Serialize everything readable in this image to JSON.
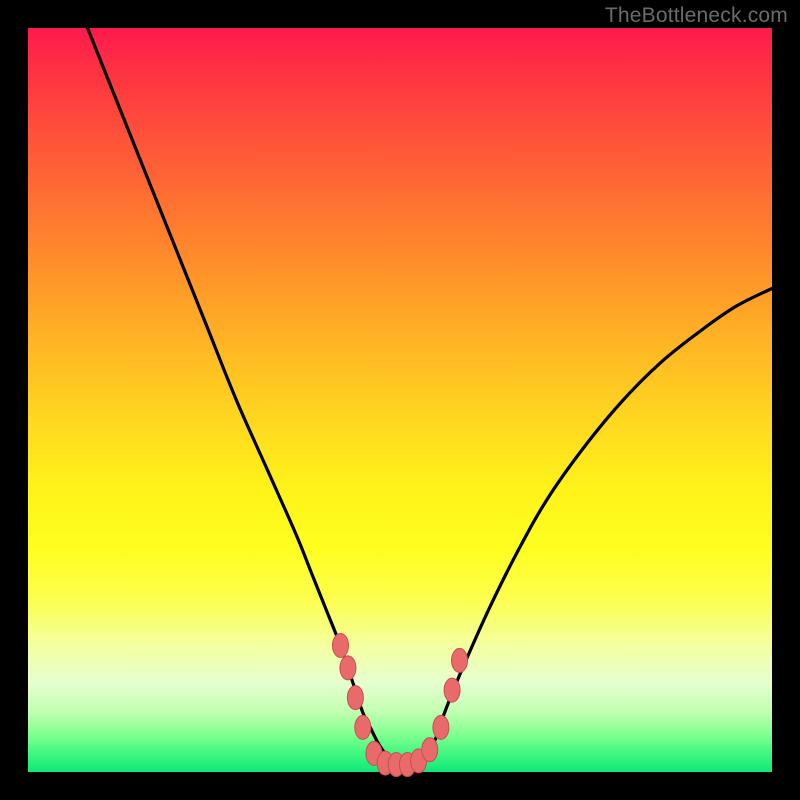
{
  "watermark": "TheBottleneck.com",
  "colors": {
    "frame": "#000000",
    "curve": "#000000",
    "marker_fill": "#e86a6a",
    "marker_stroke": "#c94f4f"
  },
  "chart_data": {
    "type": "line",
    "title": "",
    "xlabel": "",
    "ylabel": "",
    "xlim": [
      0,
      100
    ],
    "ylim": [
      0,
      100
    ],
    "note": "Bottleneck-style V curve; x is normalized component balance (arbitrary), y is bottleneck percentage. Values estimated from pixel positions (no axis ticks present).",
    "series": [
      {
        "name": "bottleneck-curve",
        "x": [
          8,
          12,
          16,
          20,
          24,
          28,
          32,
          36,
          38,
          40,
          42,
          43,
          44,
          45,
          46,
          47,
          48,
          49,
          50,
          51,
          52,
          53,
          54,
          55,
          56,
          58,
          62,
          66,
          70,
          75,
          80,
          85,
          90,
          95,
          100
        ],
        "y": [
          100,
          90,
          80,
          70,
          60,
          50,
          41,
          32,
          27,
          22,
          17,
          14,
          11,
          8,
          6,
          4,
          2.5,
          1.5,
          1,
          1,
          1.2,
          1.8,
          3,
          5,
          8,
          13,
          22,
          30,
          37,
          44,
          50,
          55,
          59,
          62.5,
          65
        ]
      }
    ],
    "markers": {
      "name": "highlight-cluster",
      "points": [
        {
          "x": 42,
          "y": 17
        },
        {
          "x": 43,
          "y": 14
        },
        {
          "x": 44,
          "y": 10
        },
        {
          "x": 45,
          "y": 6
        },
        {
          "x": 46.5,
          "y": 2.5
        },
        {
          "x": 48,
          "y": 1.2
        },
        {
          "x": 49.5,
          "y": 1
        },
        {
          "x": 51,
          "y": 1
        },
        {
          "x": 52.5,
          "y": 1.5
        },
        {
          "x": 54,
          "y": 3
        },
        {
          "x": 55.5,
          "y": 6
        },
        {
          "x": 57,
          "y": 11
        },
        {
          "x": 58,
          "y": 15
        }
      ]
    }
  }
}
